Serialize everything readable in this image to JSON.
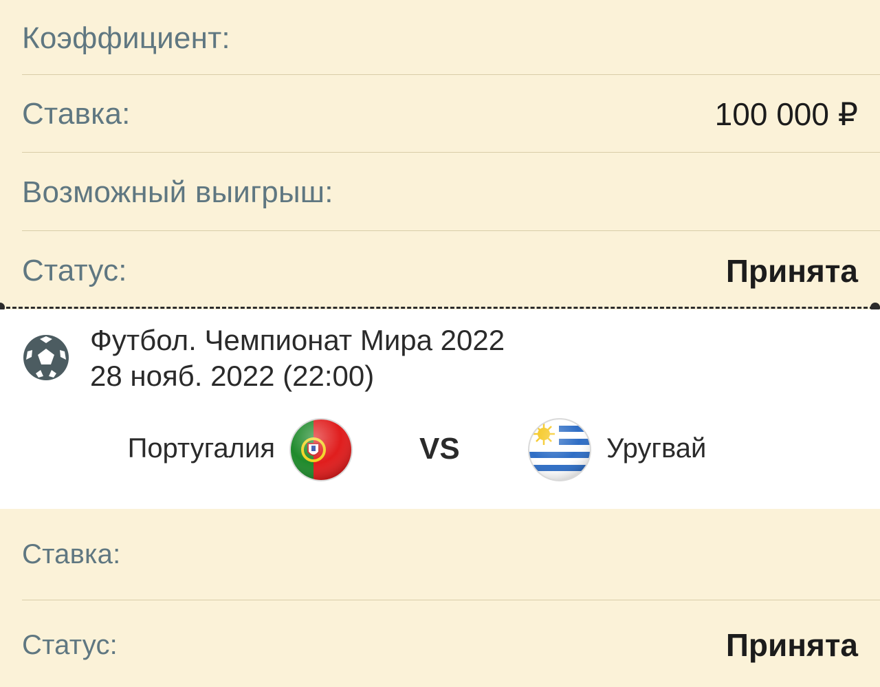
{
  "summary": {
    "coefficient_label": "Коэффициент:",
    "coefficient_value": "",
    "stake_label": "Ставка:",
    "stake_value": "100 000 ₽",
    "potential_win_label": "Возможный выигрыш:",
    "potential_win_value": "",
    "status_label": "Статус:",
    "status_value": "Принята"
  },
  "event": {
    "sport_icon": "soccer-ball-icon",
    "title": "Футбол. Чемпионат Мира 2022",
    "date": "28 нояб. 2022 (22:00)",
    "home_team": "Португалия",
    "home_flag": "portugal-flag-icon",
    "vs_label": "VS",
    "away_team": "Уругвай",
    "away_flag": "uruguay-flag-icon"
  },
  "details": {
    "stake_label": "Ставка:",
    "stake_value": "",
    "status_label": "Статус:",
    "status_value": "Принята"
  },
  "colors": {
    "background": "#fbf2d8",
    "label": "#5f7781",
    "value": "#1c1c1c",
    "card": "#ffffff",
    "divider": "#d8cda8"
  }
}
